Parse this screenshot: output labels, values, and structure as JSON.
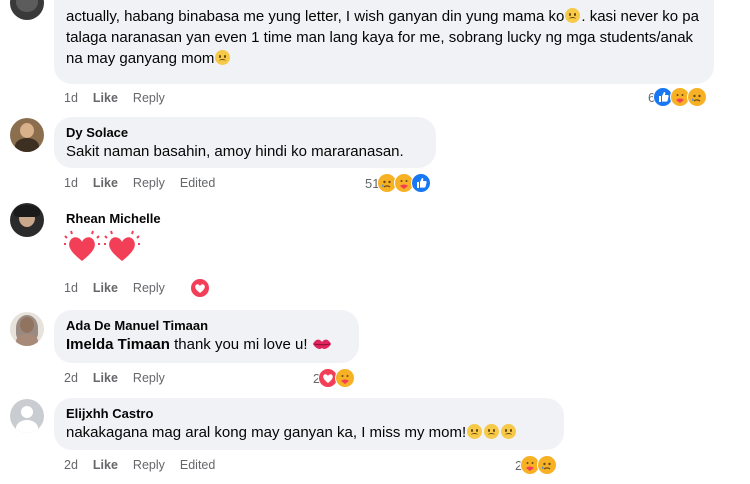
{
  "comments": [
    {
      "text_parts": [
        "actually, habang binabasa me yung letter, I wish ganyan din yung mama ko",
        ". kasi never ko pa talaga naranasan yan even 1 time man lang kaya for me, sobrang lucky ng mga students/anak na may ganyang mom"
      ],
      "time": "1d",
      "like": "Like",
      "reply": "Reply",
      "reaction_count": "6"
    },
    {
      "author": "Dy Solace",
      "text": "Sakit naman basahin, amoy hindi ko mararanasan.",
      "time": "1d",
      "like": "Like",
      "reply": "Reply",
      "edited": "Edited",
      "reaction_count": "51"
    },
    {
      "author": "Rhean Michelle",
      "time": "1d",
      "like": "Like",
      "reply": "Reply"
    },
    {
      "author": "Ada De Manuel Timaan",
      "mention": "Imelda Timaan",
      "text": " thank you mi love u! ",
      "time": "2d",
      "like": "Like",
      "reply": "Reply",
      "reaction_count": "2"
    },
    {
      "author": "Elijxhh Castro",
      "text": "nakakagana mag aral kong may ganyan ka, I miss my mom!",
      "time": "2d",
      "like": "Like",
      "reply": "Reply",
      "edited": "Edited",
      "reaction_count": "2"
    }
  ],
  "colors": {
    "bubble": "#f0f2f5",
    "muted": "#65676b",
    "like_blue": "#1877f2",
    "love_red": "#f33e58",
    "care_yellow": "#f7b125"
  },
  "icons": [
    "like-reaction-icon",
    "care-reaction-icon",
    "sad-reaction-icon",
    "love-reaction-icon",
    "heart-emoji-icon",
    "kiss-emoji-icon",
    "disappointed-emoji-icon",
    "default-avatar-icon"
  ]
}
